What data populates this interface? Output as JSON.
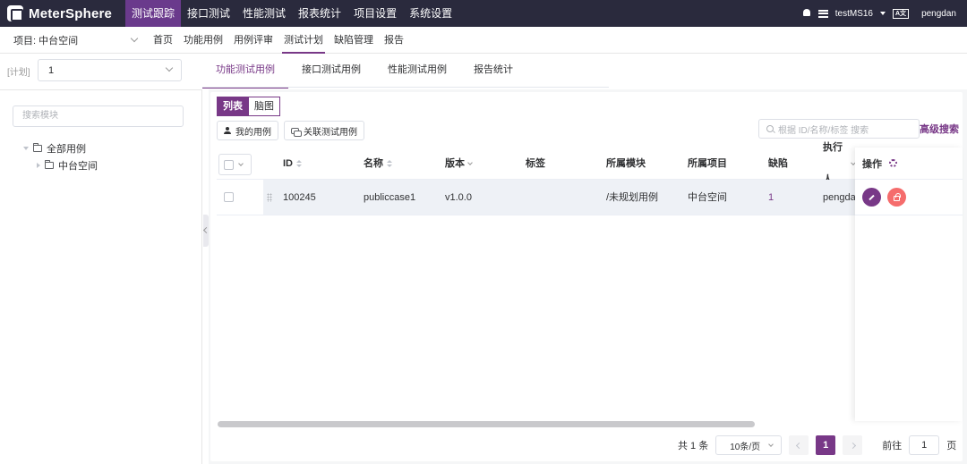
{
  "app": {
    "name": "MeterSphere"
  },
  "topnav": [
    "测试跟踪",
    "接口测试",
    "性能测试",
    "报表统计",
    "项目设置",
    "系统设置"
  ],
  "topbar_right": {
    "workspace": "testMS16",
    "username": "pengdan"
  },
  "project": {
    "label": "项目: 中台空间"
  },
  "subnav": [
    "首页",
    "功能用例",
    "用例评审",
    "测试计划",
    "缺陷管理",
    "报告"
  ],
  "plan": {
    "label": "[计划]",
    "value": "1"
  },
  "tabs": [
    "功能测试用例",
    "接口测试用例",
    "性能测试用例",
    "报告统计"
  ],
  "left": {
    "search_placeholder": "搜索模块",
    "tree": {
      "root": "全部用例",
      "child": "中台空间"
    }
  },
  "toolbar": {
    "view_list": "列表",
    "view_mind": "脑图",
    "my_cases": "我的用例",
    "link_cases": "关联测试用例",
    "search_placeholder": "根据 ID/名称/标签 搜索",
    "advanced_search": "高级搜索"
  },
  "table": {
    "columns": [
      "ID",
      "名称",
      "版本",
      "标签",
      "所属模块",
      "所属项目",
      "缺陷",
      "执行人",
      "操作"
    ],
    "rows": [
      {
        "id": "100245",
        "name": "publiccase1",
        "version": "v1.0.0",
        "tags": "",
        "module": "/未规划用例",
        "project": "中台空间",
        "bugs": "1",
        "executor": "pengdan"
      }
    ]
  },
  "pagination": {
    "total": "共 1 条",
    "page_size": "10条/页",
    "current": "1",
    "goto_label": "前往",
    "goto_value": "1",
    "page_unit": "页"
  },
  "colors": {
    "brand": "#783887",
    "topbar": "#2a2a3d",
    "danger": "#f56c6c"
  }
}
